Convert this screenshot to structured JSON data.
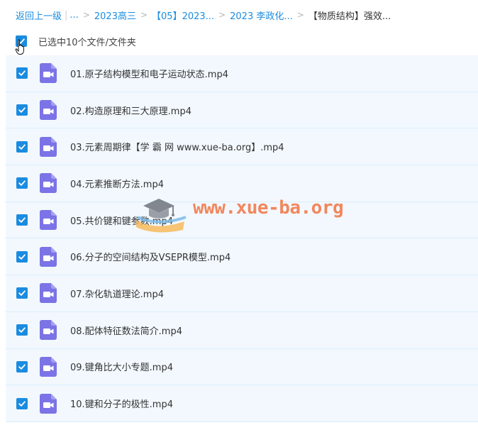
{
  "breadcrumb": {
    "back": "返回上一级",
    "ellipsis": "...",
    "items": [
      "2023高三",
      "【05】2023...",
      "2023 李政化...",
      "【物质结构】强效..."
    ]
  },
  "selection": {
    "text": "已选中10个文件/文件夹",
    "all_checked": true
  },
  "files": [
    {
      "name": "01.原子结构模型和电子运动状态.mp4",
      "checked": true,
      "icon": "video-file-icon"
    },
    {
      "name": "02.构造原理和三大原理.mp4",
      "checked": true,
      "icon": "video-file-icon"
    },
    {
      "name": "03.元素周期律【学 霸 网 www.xue-ba.org】.mp4",
      "checked": true,
      "icon": "video-file-icon"
    },
    {
      "name": "04.元素推断方法.mp4",
      "checked": true,
      "icon": "video-file-icon"
    },
    {
      "name": "05.共价键和键参数.mp4",
      "checked": true,
      "icon": "video-file-icon"
    },
    {
      "name": "06.分子的空间结构及VSEPR模型.mp4",
      "checked": true,
      "icon": "video-file-icon"
    },
    {
      "name": "07.杂化轨道理论.mp4",
      "checked": true,
      "icon": "video-file-icon"
    },
    {
      "name": "08.配体特征数法简介.mp4",
      "checked": true,
      "icon": "video-file-icon"
    },
    {
      "name": "09.键角比大小专题.mp4",
      "checked": true,
      "icon": "video-file-icon"
    },
    {
      "name": "10.键和分子的极性.mp4",
      "checked": true,
      "icon": "video-file-icon"
    }
  ],
  "watermark": {
    "text": "www.xue-ba.org"
  },
  "colors": {
    "accent": "#1a8ce0",
    "row_background": "#f2f8fe",
    "video_icon": "#7b73e6",
    "watermark": "#f26f3a"
  }
}
